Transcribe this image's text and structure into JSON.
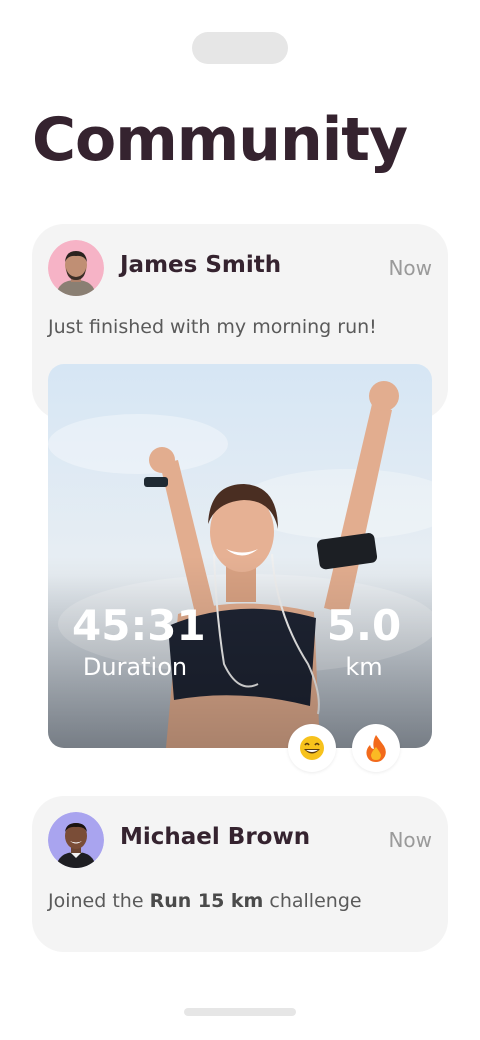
{
  "title": "Community",
  "posts": [
    {
      "name": "James Smith",
      "time": "Now",
      "message": "Just finished with my morning run!",
      "avatar_bg": "#f6b3c6",
      "stats": {
        "duration_value": "45:31",
        "duration_label": "Duration",
        "distance_value": "5.0",
        "distance_label": "km"
      },
      "reactions": [
        "grinning-face-icon",
        "fire-icon"
      ]
    },
    {
      "name": "Michael Brown",
      "time": "Now",
      "message_prefix": "Joined the ",
      "message_highlight": "Run 15 km",
      "message_suffix": " challenge",
      "avatar_bg": "#a9a4ef"
    }
  ],
  "colors": {
    "title": "#35232f",
    "card_bg": "#f4f4f4",
    "muted": "#9a9a9a"
  }
}
